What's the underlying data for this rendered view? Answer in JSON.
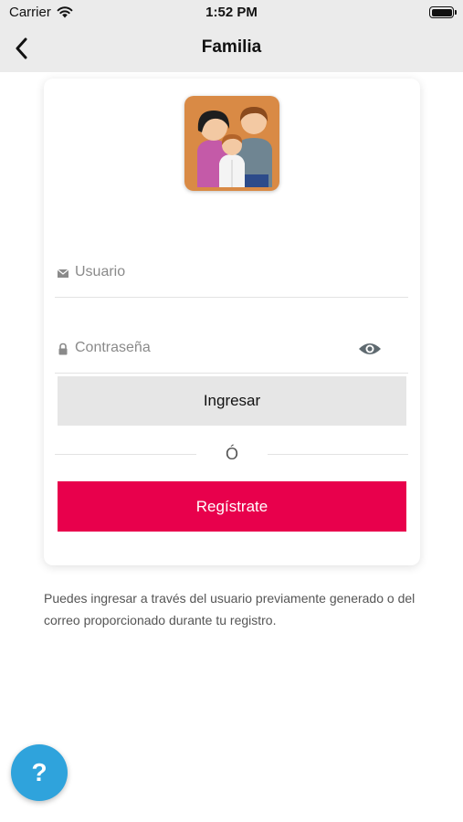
{
  "status_bar": {
    "carrier": "Carrier",
    "time": "1:52 PM",
    "wifi_icon": "wifi-icon",
    "battery_icon": "battery-icon"
  },
  "nav": {
    "title": "Familia",
    "back_icon": "chevron-left-icon"
  },
  "form": {
    "logo_icon": "family-icon",
    "username": {
      "value": "",
      "placeholder": "Usuario",
      "icon": "envelope-icon"
    },
    "password": {
      "value": "",
      "placeholder": "Contraseña",
      "icon": "lock-icon",
      "toggle_icon": "eye-icon"
    },
    "login_label": "Ingresar",
    "divider_label": "Ó",
    "register_label": "Regístrate"
  },
  "info_text": "Puedes ingresar a través del usuario previamente generado o del correo proporcionado durante tu registro.",
  "help": {
    "label": "?",
    "icon": "help-icon"
  },
  "colors": {
    "header_bg": "#ebebeb",
    "login_bg": "#e6e6e6",
    "register_bg": "#e8004c",
    "help_bg": "#2fa3dc",
    "logo_bg": "#d98a45"
  }
}
